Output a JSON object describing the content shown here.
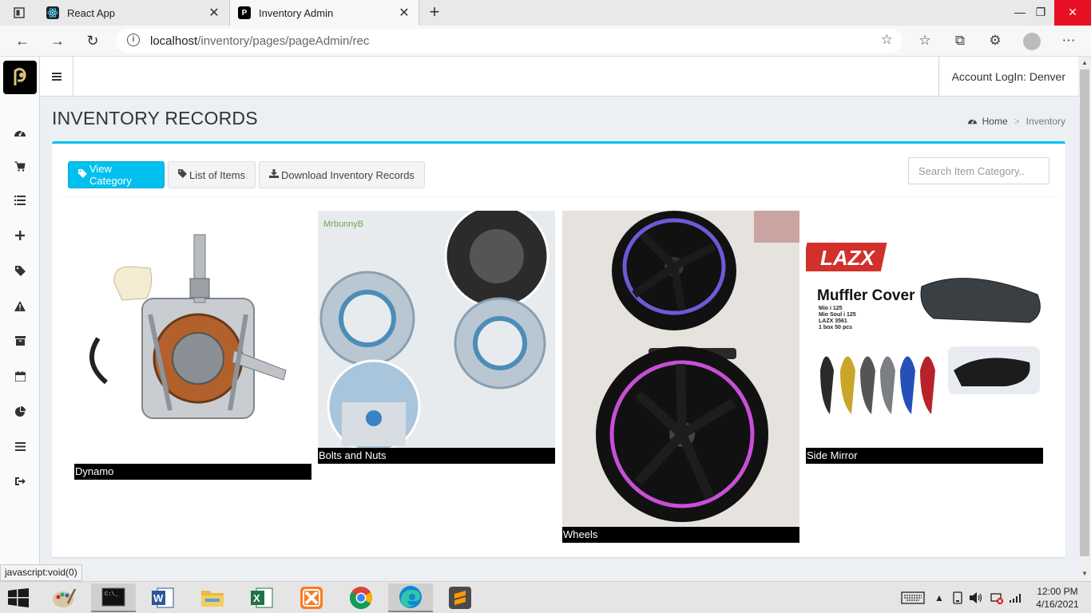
{
  "browser": {
    "tabs": [
      {
        "title": "React App",
        "active": false
      },
      {
        "title": "Inventory Admin",
        "active": true
      }
    ],
    "url_host": "localhost",
    "url_path": "/inventory/pages/pageAdmin/rec",
    "window_controls": {
      "minimize": "—",
      "restore": "❐",
      "close": "✕"
    }
  },
  "topnav": {
    "account": "Account LogIn: Denver"
  },
  "page": {
    "title": "INVENTORY RECORDS",
    "breadcrumb": {
      "home": "Home",
      "current": "Inventory"
    }
  },
  "toolbar": {
    "view_category": "View Category",
    "list_items": "List of Items",
    "download": "Download Inventory Records",
    "search_placeholder": "Search Item Category.."
  },
  "categories": [
    {
      "name": "Dynamo"
    },
    {
      "name": "Bolts and Nuts",
      "image_text": "MrbunnyB"
    },
    {
      "name": "Wheels"
    },
    {
      "name": "Side Mirror",
      "image_text": {
        "brand": "LAZX",
        "heading": "Muffler Cover",
        "lines": [
          "Mio i 125",
          "Mio Soul i 125",
          "LAZX 3561",
          "1 box 50 pcs"
        ]
      }
    }
  ],
  "statusbar": "javascript:void(0)",
  "taskbar": {
    "time": "12:00 PM",
    "date": "4/16/2021"
  },
  "colors": {
    "accent": "#00c0ef",
    "content_bg": "#ecf0f5",
    "close_red": "#e81123"
  }
}
